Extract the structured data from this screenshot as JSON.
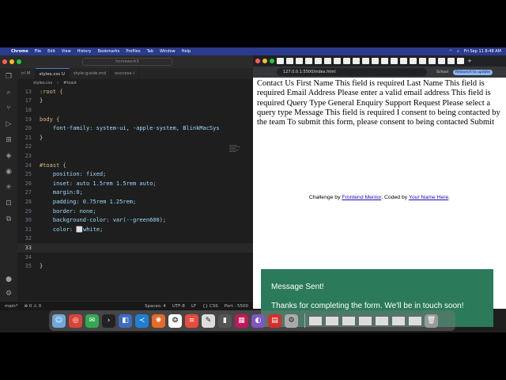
{
  "menubar": {
    "items": [
      "Chrome",
      "File",
      "Edit",
      "View",
      "History",
      "Bookmarks",
      "Profiles",
      "Tab",
      "Window",
      "Help"
    ],
    "clock": "Fri Sep 11  8:48 AM"
  },
  "vscode": {
    "search": "homework3",
    "tabs": [
      "nl M",
      "styles.css U",
      "style-guide.md",
      "success-i"
    ],
    "breadcrumb": [
      "styles.css",
      "#toast"
    ],
    "lines": [
      {
        "n": "13",
        "code": ":root {"
      },
      {
        "n": "17",
        "code": "}"
      },
      {
        "n": "18",
        "code": ""
      },
      {
        "n": "19",
        "code": "body {"
      },
      {
        "n": "20",
        "code": "    font-family: system-ui, -apple-system, BlinkMacSys"
      },
      {
        "n": "21",
        "code": "}"
      },
      {
        "n": "22",
        "code": ""
      },
      {
        "n": "23",
        "code": ""
      },
      {
        "n": "24",
        "code": "#toast {"
      },
      {
        "n": "25",
        "code": "    position: fixed;"
      },
      {
        "n": "26",
        "code": "    inset: auto 1.5rem 1.5rem auto;"
      },
      {
        "n": "27",
        "code": "    margin:0;"
      },
      {
        "n": "28",
        "code": "    padding: 0.75rem 1.25rem;"
      },
      {
        "n": "29",
        "code": "    border: none;"
      },
      {
        "n": "30",
        "code": "    background-color: var(--green600);"
      },
      {
        "n": "31",
        "code": "    color: ⬜white;"
      },
      {
        "n": "32",
        "code": ""
      },
      {
        "n": "33",
        "code": ""
      },
      {
        "n": "34",
        "code": ""
      },
      {
        "n": "35",
        "code": "}"
      }
    ],
    "status": {
      "branch": "main*",
      "problems": "⊗ 0 ⚠ 0",
      "spaces": "Spaces: 4",
      "encoding": "UTF-8",
      "eol": "LF",
      "lang": "{} CSS",
      "port": "Port : 5500"
    }
  },
  "chrome": {
    "url": "127.0.0.1:5500/index.html",
    "school": "School",
    "relaunch": "Relaunch to update",
    "form_text": "Contact Us First Name This field is required Last Name This field is required Email Address Please enter a valid email address This field is required Query Type General Enquiry Support Request Please select a query type Message This field is required I consent to being contacted by the team To submit this form, please consent to being contacted Submit",
    "attribution": {
      "prefix": "Challenge by ",
      "link1": "Frontend Mentor",
      "middle": ". Coded by ",
      "link2": "Your Name Here",
      "suffix": "."
    },
    "toast": {
      "title": "Message Sent!",
      "body": "Thanks for completing the form. We'll be in touch soon!"
    }
  },
  "colors": {
    "toast_bg": "#2b7a5a",
    "menubar_bg": "#2a3a8c"
  }
}
